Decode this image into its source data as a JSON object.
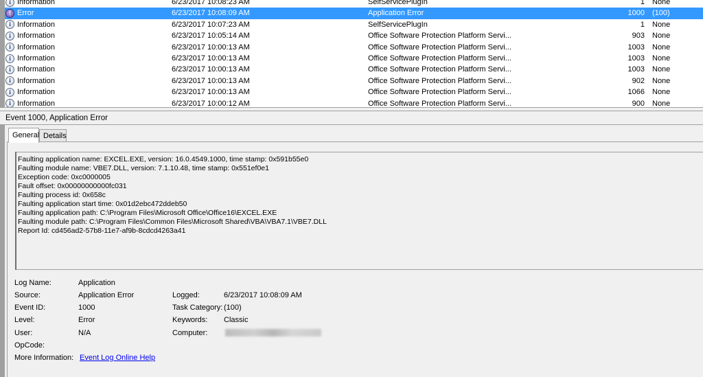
{
  "events": [
    {
      "level": "Information",
      "date": "6/23/2017 10:08:23 AM",
      "source": "SelfServicePlugIn",
      "id": "1",
      "task": "None",
      "icon": "info-icon"
    },
    {
      "level": "Error",
      "date": "6/23/2017 10:08:09 AM",
      "source": "Application Error",
      "id": "1000",
      "task": "(100)",
      "icon": "error-icon",
      "selected": true
    },
    {
      "level": "Information",
      "date": "6/23/2017 10:07:23 AM",
      "source": "SelfServicePlugIn",
      "id": "1",
      "task": "None",
      "icon": "info-icon"
    },
    {
      "level": "Information",
      "date": "6/23/2017 10:05:14 AM",
      "source": "Office Software Protection Platform Servi...",
      "id": "903",
      "task": "None",
      "icon": "info-icon"
    },
    {
      "level": "Information",
      "date": "6/23/2017 10:00:13 AM",
      "source": "Office Software Protection Platform Servi...",
      "id": "1003",
      "task": "None",
      "icon": "info-icon"
    },
    {
      "level": "Information",
      "date": "6/23/2017 10:00:13 AM",
      "source": "Office Software Protection Platform Servi...",
      "id": "1003",
      "task": "None",
      "icon": "info-icon"
    },
    {
      "level": "Information",
      "date": "6/23/2017 10:00:13 AM",
      "source": "Office Software Protection Platform Servi...",
      "id": "1003",
      "task": "None",
      "icon": "info-icon"
    },
    {
      "level": "Information",
      "date": "6/23/2017 10:00:13 AM",
      "source": "Office Software Protection Platform Servi...",
      "id": "902",
      "task": "None",
      "icon": "info-icon"
    },
    {
      "level": "Information",
      "date": "6/23/2017 10:00:13 AM",
      "source": "Office Software Protection Platform Servi...",
      "id": "1066",
      "task": "None",
      "icon": "info-icon"
    },
    {
      "level": "Information",
      "date": "6/23/2017 10:00:12 AM",
      "source": "Office Software Protection Platform Servi...",
      "id": "900",
      "task": "None",
      "icon": "info-icon"
    }
  ],
  "detail": {
    "header": "Event 1000, Application Error",
    "tabs": [
      "General",
      "Details"
    ],
    "description": "Faulting application name: EXCEL.EXE, version: 16.0.4549.1000, time stamp: 0x591b55e0\nFaulting module name: VBE7.DLL, version: 7.1.10.48, time stamp: 0x551ef0e1\nException code: 0xc0000005\nFault offset: 0x00000000000fc031\nFaulting process id: 0x658c\nFaulting application start time: 0x01d2ebc472ddeb50\nFaulting application path: C:\\Program Files\\Microsoft Office\\Office16\\EXCEL.EXE\nFaulting module path: C:\\Program Files\\Common Files\\Microsoft Shared\\VBA\\VBA7.1\\VBE7.DLL\nReport Id: cd456ad2-57b8-11e7-af9b-8cdcd4263a41",
    "labels": {
      "log_name": "Log Name:",
      "source": "Source:",
      "event_id": "Event ID:",
      "level": "Level:",
      "user": "User:",
      "opcode": "OpCode:",
      "more_info": "More Information:",
      "logged": "Logged:",
      "task_category": "Task Category:",
      "keywords": "Keywords:",
      "computer": "Computer:"
    },
    "values": {
      "log_name": "Application",
      "source": "Application Error",
      "event_id": "1000",
      "level": "Error",
      "user": "N/A",
      "opcode": "",
      "more_info": "Event Log Online Help",
      "logged": "6/23/2017 10:08:09 AM",
      "task_category": "(100)",
      "keywords": "Classic"
    }
  },
  "colors": {
    "selection": "#3399ff",
    "link": "#0000ee"
  }
}
